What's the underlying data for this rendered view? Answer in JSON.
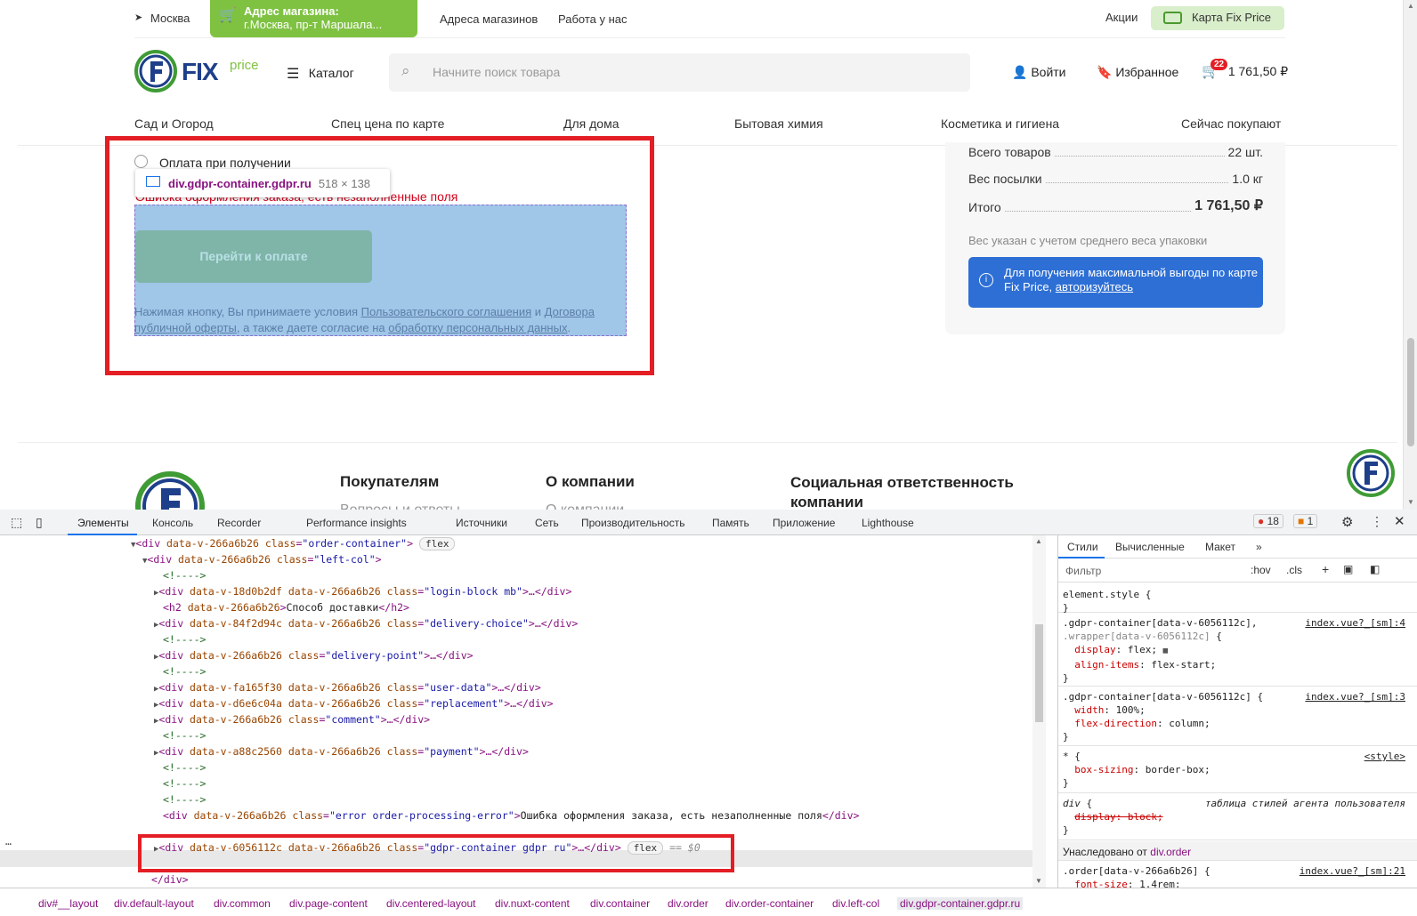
{
  "topbar": {
    "city": "Москва",
    "address_title": "Адрес магазина:",
    "address_value": "г.Москва, пр-т Маршала...",
    "stores": "Адреса магазинов",
    "jobs": "Работа у нас",
    "promos": "Акции",
    "card": "Карта Fix Price"
  },
  "header": {
    "logo_text": "FIX",
    "logo_sub": "price",
    "catalog": "Каталог",
    "search_placeholder": "Начните поиск товара",
    "login": "Войти",
    "favorites": "Избранное",
    "cart_count": "22",
    "cart_total": "1 761,50 ₽"
  },
  "menu": [
    "Сад и Огород",
    "Спец цена по карте",
    "Для дома",
    "Бытовая химия",
    "Косметика и гигиена",
    "Сейчас покупают"
  ],
  "order": {
    "payment_option": "Оплата при получении",
    "error": "Ошибка оформления заказа, есть незаполненные поля",
    "pay_button": "Перейти к оплате",
    "consent_1": "Нажимая кнопку, Вы принимаете условия ",
    "consent_link1": "Пользовательского соглашения",
    "consent_2": " и ",
    "consent_link2": "Договора публичной оферты",
    "consent_3": ", а также даете согласие на ",
    "consent_link3": "обработку персональных данных",
    "consent_4": "."
  },
  "tooltip": {
    "name": "div.gdpr-container.gdpr.ru",
    "size": "518 × 138"
  },
  "summary": {
    "rows": [
      {
        "label": "Всего товаров",
        "value": "22 шт."
      },
      {
        "label": "Вес посылки",
        "value": "1.0 кг"
      },
      {
        "label": "Итого",
        "value": "1 761,50 ₽"
      }
    ],
    "note": "Вес указан с учетом среднего веса упаковки",
    "info": "Для получения максимальной выгоды по карте Fix Price,",
    "info_link": "авторизуйтесь"
  },
  "footer": {
    "col1": "Покупателям",
    "col1_link": "Вопросы и ответы",
    "col2": "О компании",
    "col2_link": "О компании",
    "col3": "Социальная ответственность компании"
  },
  "devtools": {
    "tabs": [
      "Элементы",
      "Консоль",
      "Recorder",
      "Performance insights",
      "Источники",
      "Сеть",
      "Производительность",
      "Память",
      "Приложение",
      "Lighthouse"
    ],
    "errors": "18",
    "warnings": "1",
    "styles_tabs": [
      "Стили",
      "Вычисленные",
      "Макет"
    ],
    "filter": "Фильтр",
    "hov": ":hov",
    "cls": ".cls",
    "inherited_label": "Унаследовано от",
    "inherited_from": "div.order",
    "ua_label": "таблица стилей агента пользователя",
    "breadcrumbs": [
      "div#__layout",
      "div.default-layout",
      "div.common",
      "div.page-content",
      "div.centered-layout",
      "div.nuxt-content",
      "div.container",
      "div.order",
      "div.order-container",
      "div.left-col",
      "div.gdpr-container.gdpr.ru"
    ],
    "flex_badge": "flex",
    "dollar0": "== $0",
    "error_text": "Ошибка оформления заказа, есть незаполненные поля",
    "h2_text": "Способ доставки"
  }
}
